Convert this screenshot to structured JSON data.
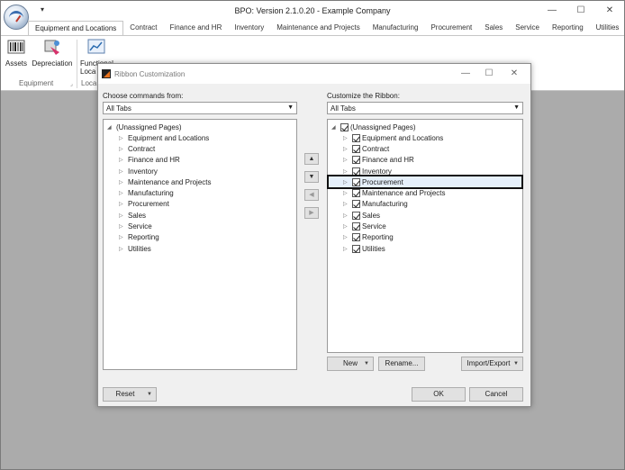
{
  "app": {
    "title": "BPO: Version 2.1.0.20 - Example Company",
    "qat_arrow": "▾",
    "window_controls": {
      "minimize": "—",
      "maximize": "☐",
      "close": "✕"
    }
  },
  "ribbon": {
    "tabs": [
      "Equipment and Locations",
      "Contract",
      "Finance and HR",
      "Inventory",
      "Maintenance and Projects",
      "Manufacturing",
      "Procurement",
      "Sales",
      "Service",
      "Reporting",
      "Utilities"
    ],
    "active_tab": "Equipment and Locations",
    "buttons": {
      "assets": "Assets",
      "depreciation": "Depreciation",
      "functional_line1": "Functional",
      "functional_line2": "Loca"
    },
    "groups": {
      "equipment": "Equipment",
      "locations": "Loca"
    }
  },
  "dialog": {
    "title": "Ribbon Customization",
    "window_controls": {
      "minimize": "—",
      "maximize": "☐",
      "close": "✕"
    },
    "left": {
      "label": "Choose commands from:",
      "combo_value": "All Tabs",
      "root": "(Unassigned Pages)",
      "items": [
        "Equipment and Locations",
        "Contract",
        "Finance and HR",
        "Inventory",
        "Maintenance and Projects",
        "Manufacturing",
        "Procurement",
        "Sales",
        "Service",
        "Reporting",
        "Utilities"
      ]
    },
    "right": {
      "label": "Customize the Ribbon:",
      "combo_value": "All Tabs",
      "root": "(Unassigned Pages)",
      "items": [
        "Equipment and Locations",
        "Contract",
        "Finance and HR",
        "Inventory",
        "Procurement",
        "Maintenance and Projects",
        "Manufacturing",
        "Sales",
        "Service",
        "Reporting",
        "Utilities"
      ],
      "selected": "Procurement"
    },
    "mid_buttons": {
      "up": "▲",
      "down": "▼",
      "add": "◀",
      "remove": "▶"
    },
    "buttons": {
      "new": "New",
      "rename": "Rename...",
      "import_export": "Import/Export",
      "reset": "Reset",
      "ok": "OK",
      "cancel": "Cancel"
    }
  },
  "colors": {
    "accent_orange": "#e8731e",
    "workspace": "#ababab",
    "selection_outline": "#111111"
  }
}
